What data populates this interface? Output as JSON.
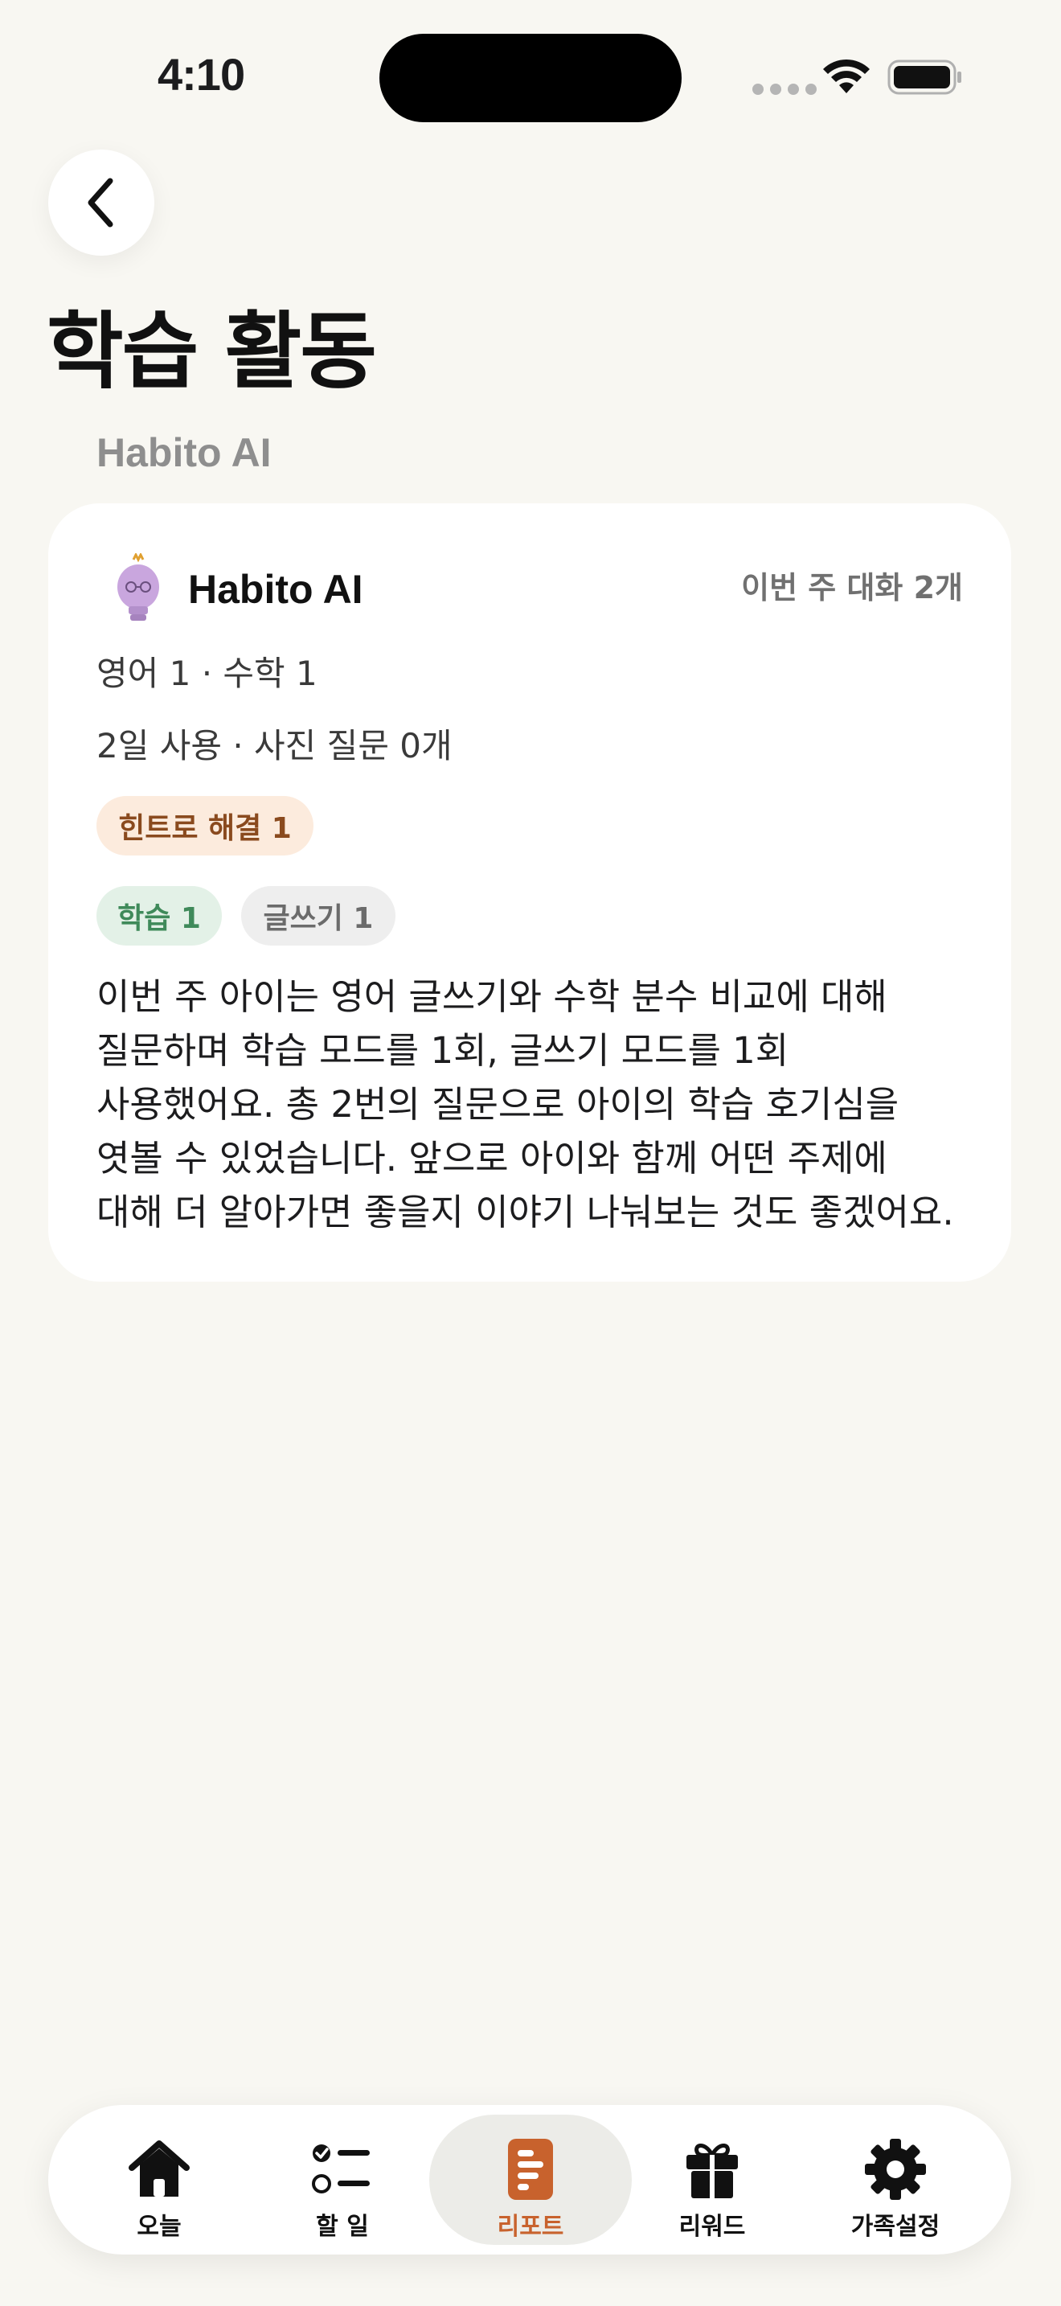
{
  "status_bar": {
    "time": "4:10"
  },
  "header": {
    "title": "학습 활동",
    "section_label": "Habito AI"
  },
  "card": {
    "ai_name": "Habito AI",
    "weekly_count": "이번 주 대화 2개",
    "subjects": "영어 1 · 수학 1",
    "usage": "2일 사용 · 사진 질문 0개",
    "hint_chip": "힌트로 해결 1",
    "mode_chips": {
      "study": "학습 1",
      "writing": "글쓰기 1"
    },
    "summary": "이번 주 아이는 영어 글쓰기와 수학 분수 비교에 대해 질문하며 학습 모드를 1회, 글쓰기 모드를 1회 사용했어요. 총 2번의 질문으로 아이의 학습 호기심을 엿볼 수 있었습니다. 앞으로 아이와 함께 어떤 주제에 대해 더 알아가면 좋을지 이야기 나눠보는 것도 좋겠어요."
  },
  "tab_bar": {
    "active": "리포트",
    "accent_color": "#C8622D",
    "items": [
      {
        "label": "오늘",
        "icon": "home-icon"
      },
      {
        "label": "할 일",
        "icon": "checklist-icon"
      },
      {
        "label": "리포트",
        "icon": "report-icon"
      },
      {
        "label": "리워드",
        "icon": "gift-icon"
      },
      {
        "label": "가족설정",
        "icon": "gear-icon"
      }
    ]
  }
}
